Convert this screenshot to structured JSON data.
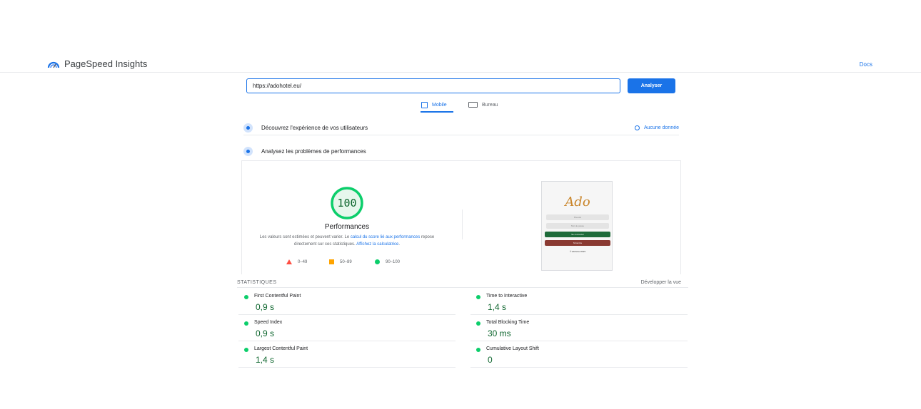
{
  "header": {
    "brand": "PageSpeed Insights",
    "docs": "Docs"
  },
  "search": {
    "url": "https://adohotel.eu/",
    "analyze_label": "Analyser"
  },
  "tabs": [
    {
      "label": "Mobile",
      "active": true
    },
    {
      "label": "Bureau",
      "active": false
    }
  ],
  "sections": {
    "experience_title": "Découvrez l'expérience de vos utilisateurs",
    "no_data": "Aucune donnée",
    "performance_title": "Analysez les problèmes de performances"
  },
  "score": {
    "value": "100",
    "label": "Performances",
    "desc_prefix": "Les valeurs sont estimées et peuvent varier. Le ",
    "desc_link1": "calcul du score lié aux performances",
    "desc_middle": " repose directement sur ces statistiques. ",
    "desc_link2": "Affichez la calculatrice",
    "desc_suffix": "."
  },
  "legend": [
    {
      "range": "0–49",
      "color": "#ff4e42"
    },
    {
      "range": "50–89",
      "color": "#ffa400"
    },
    {
      "range": "90–100",
      "color": "#0cce6b"
    }
  ],
  "screenshot_preview": {
    "logo": "Ado",
    "field1": "Pseudo",
    "field2": "Mot de passe",
    "btn1": "Se connecter",
    "btn2": "S'inscrire",
    "footer": "© adohotel 2023"
  },
  "stats": {
    "label": "STATISTIQUES",
    "expand": "Développer la vue",
    "metrics": [
      {
        "name": "First Contentful Paint",
        "value": "0,9 s"
      },
      {
        "name": "Time to Interactive",
        "value": "1,4 s"
      },
      {
        "name": "Speed Index",
        "value": "0,9 s"
      },
      {
        "name": "Total Blocking Time",
        "value": "30 ms"
      },
      {
        "name": "Largest Contentful Paint",
        "value": "1,4 s"
      },
      {
        "name": "Cumulative Layout Shift",
        "value": "0"
      }
    ]
  },
  "colors": {
    "accent": "#1a73e8",
    "pass": "#0cce6b",
    "pass_text": "#0d652d",
    "average": "#ffa400",
    "fail": "#ff4e42"
  }
}
